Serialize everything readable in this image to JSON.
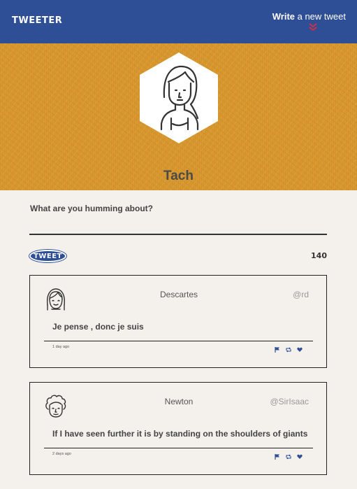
{
  "nav": {
    "brand": "TWEETER",
    "compose_bold": "Write",
    "compose_rest": " a new tweet",
    "arrow_icon": "double-chevron-down-icon",
    "arrow_color": "#c0334d"
  },
  "colors": {
    "nav": "#2e4e96",
    "header": "#d9982e",
    "background": "#f4f1ec"
  },
  "profile": {
    "name": "Tach",
    "avatar_icon": "woman-avatar-icon"
  },
  "composer": {
    "label": "What are you humming about?",
    "input_value": "",
    "button_label": "TWEET",
    "counter": "140"
  },
  "tweets": [
    {
      "name": "Descartes",
      "handle": "@rd",
      "text": "Je pense , donc je suis",
      "age": "1 day ago",
      "avatar_icon": "girl-avatar-icon",
      "actions": [
        "flag-icon",
        "retweet-icon",
        "heart-icon"
      ]
    },
    {
      "name": "Newton",
      "handle": "@SirIsaac",
      "text": "If I have seen further it is by standing on the shoulders of giants",
      "age": "2 days ago",
      "avatar_icon": "curly-hair-avatar-icon",
      "actions": [
        "flag-icon",
        "retweet-icon",
        "heart-icon"
      ]
    }
  ]
}
